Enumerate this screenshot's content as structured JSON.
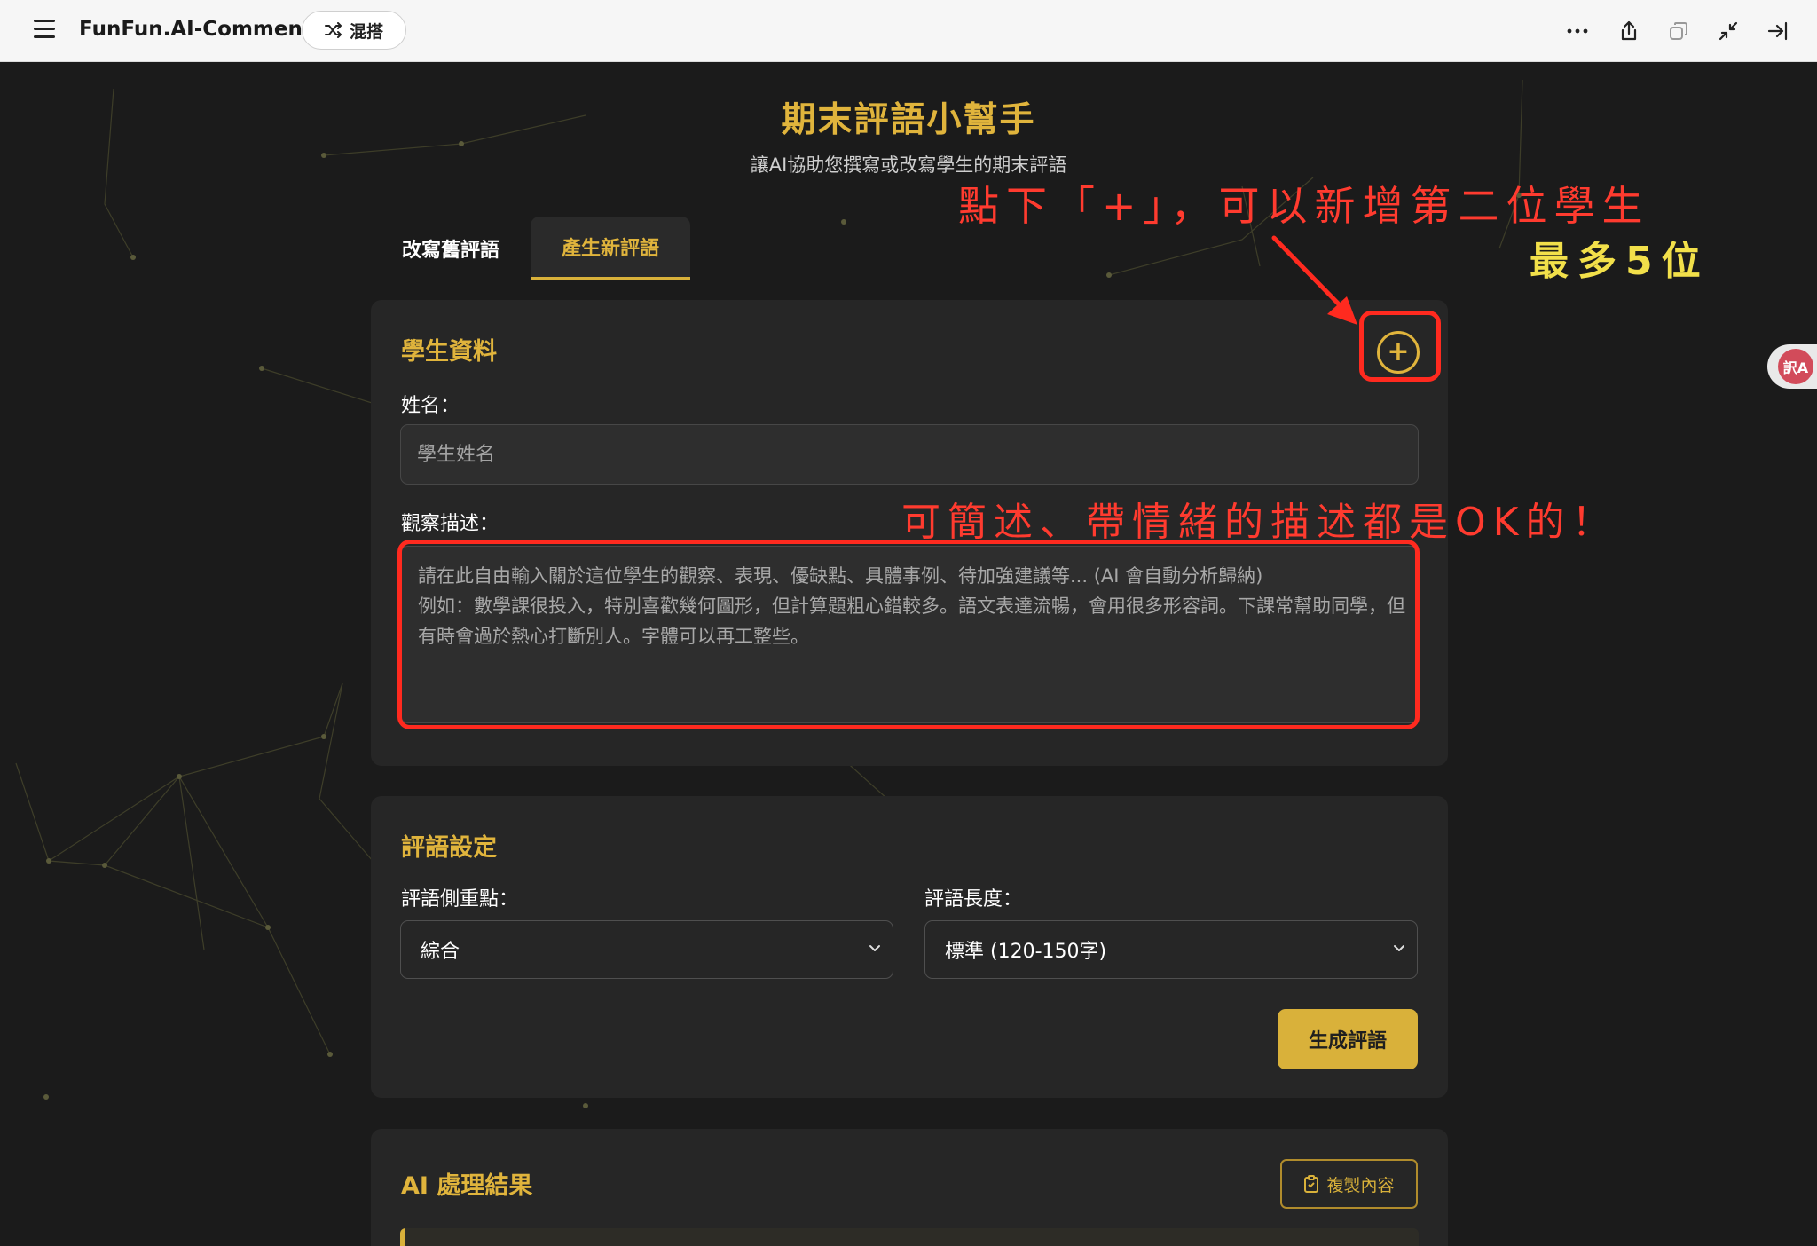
{
  "topbar": {
    "app_title": "FunFun.AI-Comments",
    "mix_label": "混搭",
    "icons": [
      "menu-icon",
      "shuffle-icon",
      "more-icon",
      "share-icon",
      "duplicate-icon",
      "minimize-icon",
      "collapse-sidebar-icon"
    ]
  },
  "header": {
    "title": "期末評語小幫手",
    "subtitle": "讓AI協助您撰寫或改寫學生的期末評語"
  },
  "tabs": [
    {
      "label": "改寫舊評語",
      "active": false
    },
    {
      "label": "產生新評語",
      "active": true
    }
  ],
  "student": {
    "heading": "學生資料",
    "add_icon": "plus-circle-icon",
    "name_label": "姓名：",
    "name_placeholder": "學生姓名",
    "desc_label": "觀察描述：",
    "desc_placeholder_line1": "請在此自由輸入關於這位學生的觀察、表現、優缺點、具體事例、待加強建議等... (AI 會自動分析歸納)",
    "desc_placeholder_line2": "例如：數學課很投入，特別喜歡幾何圖形，但計算題粗心錯較多。語文表達流暢，會用很多形容詞。下課常幫助同學，但有時會過於熱心打斷別人。字體可以再工整些。"
  },
  "settings": {
    "heading": "評語設定",
    "focus_label": "評語側重點：",
    "focus_value": "綜合",
    "length_label": "評語長度：",
    "length_value": "標準 (120-150字)",
    "generate_label": "生成評語"
  },
  "result": {
    "heading": "AI 處理結果",
    "copy_label": "複製內容"
  },
  "annotations": {
    "add_student_note": "點下「+」，可以新增第二位學生",
    "max_note": "最多5位",
    "description_note": "可簡述、帶情緒的描述都是OK的！"
  },
  "side_widget": {
    "badge": "訳A"
  },
  "colors": {
    "accent": "#e0b43c",
    "background": "#1b1b1b",
    "card": "#262626",
    "annotation_red": "#ff3b2f",
    "annotation_yellow": "#f2e04a"
  }
}
